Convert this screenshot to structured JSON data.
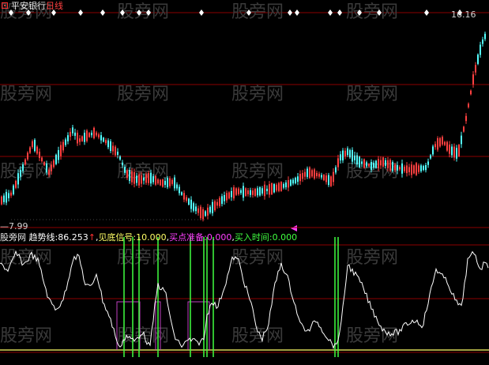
{
  "chart_title": {
    "stock_name": "平安银行",
    "period": "日线"
  },
  "price_panel": {
    "high_label": "16.16",
    "low_label": "7.99",
    "watermark": "股旁网"
  },
  "indicator_panel": {
    "name": "股旁网",
    "trend_label": "趋势线:",
    "trend_value": "86.253",
    "trend_arrow": "↑",
    "sep1": ",",
    "bottom_signal_label": "见底信号:",
    "bottom_signal_value": "10.000",
    "sep2": ",",
    "buy_prep_label": "买点准备:",
    "buy_prep_value": "0.000",
    "sep3": ",",
    "buy_time_label": "买入时间:",
    "buy_time_value": "0.000"
  },
  "colors": {
    "background": "#000000",
    "grid": "#8b0000",
    "candle_up": "#ff4040",
    "candle_down": "#54ffff",
    "trend_line": "#ffffff",
    "bottom_signal": "#ffff66",
    "buy_prep": "#c040c0",
    "buy_time": "#40ff40",
    "marker": "#ffffff",
    "cursor_marker": "#ff40ff"
  },
  "icons": {
    "title_icon": "chart-square-icon",
    "signal_marker": "white-diamond-marker-icon"
  }
}
